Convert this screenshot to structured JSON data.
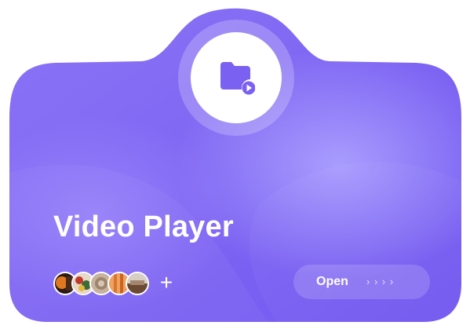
{
  "card": {
    "title": "Video Player",
    "gradient_start": "#8a6ff5",
    "gradient_end": "#7a5df0",
    "glow": "#b0a6ff"
  },
  "app_icon": {
    "icon": "folder-video-icon",
    "color": "#7b61f1"
  },
  "participants": {
    "avatars": [
      {
        "name": "avatar-1",
        "color": "#e07820"
      },
      {
        "name": "avatar-2",
        "color": "#c85a6a"
      },
      {
        "name": "avatar-3",
        "color": "#b79c86"
      },
      {
        "name": "avatar-4",
        "color": "#d9762e"
      },
      {
        "name": "avatar-5",
        "color": "#a38670"
      }
    ],
    "more_label": "+"
  },
  "open_button": {
    "label": "Open",
    "arrows": "› › › ›"
  }
}
